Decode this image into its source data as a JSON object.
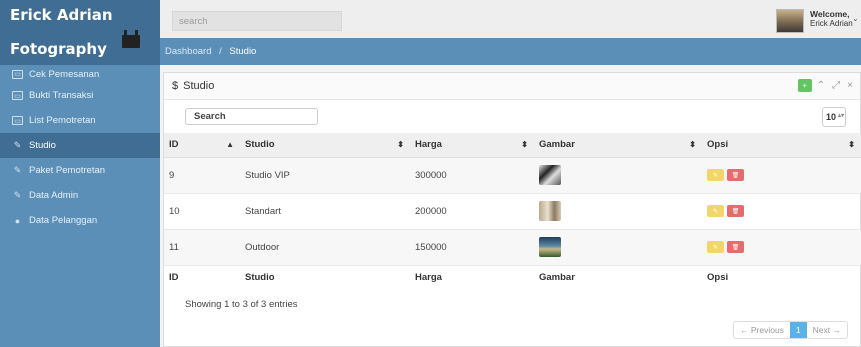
{
  "brand": {
    "line1": "Erick Adrian",
    "line2": "Fotography"
  },
  "sidebar": {
    "items": [
      {
        "label": "Cek Pemesanan",
        "icon": "image-icon"
      },
      {
        "label": "Bukti Transaksi",
        "icon": "image-icon"
      },
      {
        "label": "List Pemotretan",
        "icon": "image-icon"
      },
      {
        "label": "Studio",
        "icon": "edit-icon",
        "active": true
      },
      {
        "label": "Paket Pemotretan",
        "icon": "edit-icon"
      },
      {
        "label": "Data Admin",
        "icon": "edit-icon"
      },
      {
        "label": "Data Pelanggan",
        "icon": "map-marker-icon"
      }
    ]
  },
  "topbar": {
    "search_placeholder": "search",
    "welcome": "Welcome,",
    "user": "Erick Adrian"
  },
  "breadcrumb": {
    "root": "Dashboard",
    "separator": "/",
    "current": "Studio"
  },
  "panel": {
    "title": "Studio",
    "title_icon": "$",
    "search_label": "Search",
    "per_page": "10"
  },
  "table": {
    "headers": [
      "ID",
      "Studio",
      "Harga",
      "Gambar",
      "Opsi"
    ],
    "rows": [
      {
        "id": "9",
        "studio": "Studio VIP",
        "harga": "300000",
        "image": "studio-vip-photo"
      },
      {
        "id": "10",
        "studio": "Standart",
        "harga": "200000",
        "image": "standart-photo"
      },
      {
        "id": "11",
        "studio": "Outdoor",
        "harga": "150000",
        "image": "outdoor-photo"
      }
    ],
    "footers": [
      "ID",
      "Studio",
      "Harga",
      "Gambar",
      "Opsi"
    ]
  },
  "info": "Showing 1 to 3 of 3 entries",
  "pagination": {
    "previous": "← Previous",
    "page": "1",
    "next": "Next →"
  },
  "colors": {
    "sidebar": "#5b8fb8",
    "sidebar_dark": "#3f6d93",
    "edit": "#f2d66a",
    "delete": "#e36d6d",
    "add": "#62c462",
    "page_active": "#5ab2e8"
  }
}
